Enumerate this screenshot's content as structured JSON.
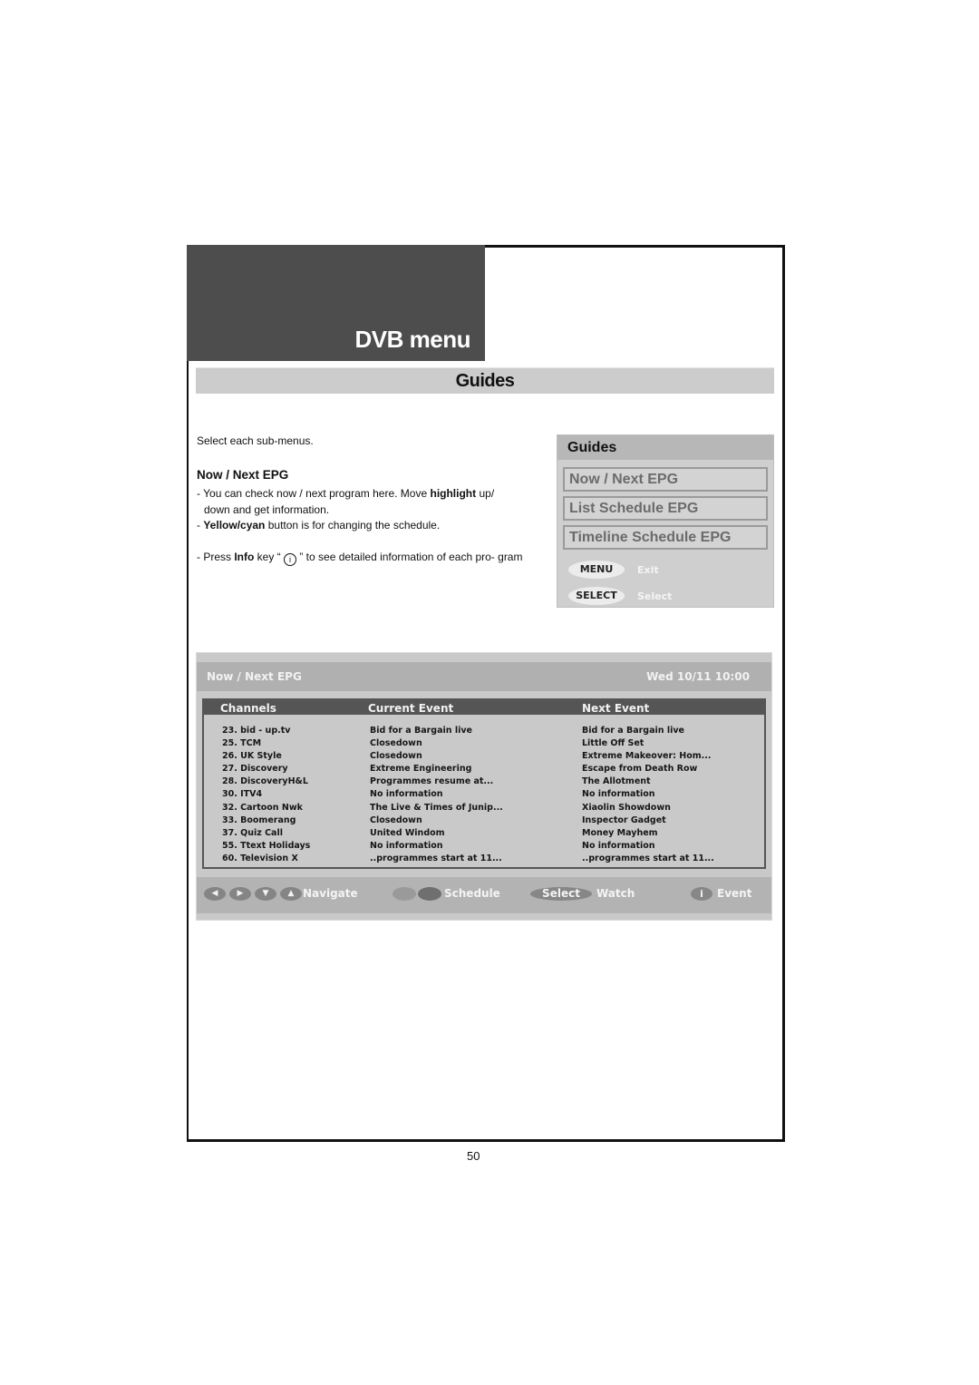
{
  "header": {
    "title": "DVB menu",
    "section": "Guides"
  },
  "intro": "Select each sub-menus.",
  "subsection": {
    "title": "Now / Next EPG",
    "bullets": [
      {
        "pre": "- You can check now / next program here. Move ",
        "bold": "highlight",
        "post": " up/ down and get information."
      },
      {
        "pre": "- ",
        "bold": "Yellow/cyan",
        "post": " button is for changing the schedule."
      },
      {
        "pre": "- Press ",
        "bold": "Info",
        "mid": " key “ ",
        "icon": "i",
        "post": " ” to see detailed information of each pro- gram"
      }
    ]
  },
  "guides_menu": {
    "title": "Guides",
    "items": [
      "Now / Next EPG",
      "List Schedule EPG",
      "Timeline Schedule EPG"
    ],
    "keys": [
      {
        "key": "MENU",
        "action": "Exit"
      },
      {
        "key": "SELECT",
        "action": "Select"
      }
    ]
  },
  "epg": {
    "title": "Now / Next EPG",
    "datetime": "Wed 10/11 10:00",
    "columns": [
      "Channels",
      "Current Event",
      "Next Event"
    ],
    "rows": [
      [
        "23. bid - up.tv",
        "Bid for a Bargain live",
        "Bid for a Bargain live"
      ],
      [
        "25. TCM",
        "Closedown",
        "Little Off Set"
      ],
      [
        "26. UK Style",
        "Closedown",
        "Extreme Makeover: Hom..."
      ],
      [
        "27. Discovery",
        "Extreme Engineering",
        "Escape from Death Row"
      ],
      [
        "28. DiscoveryH&L",
        "Programmes resume at...",
        "The Allotment"
      ],
      [
        "30. ITV4",
        "No information",
        "No information"
      ],
      [
        "32. Cartoon Nwk",
        "The Live & Times of Junip...",
        "Xiaolin Showdown"
      ],
      [
        "33. Boomerang",
        "Closedown",
        "Inspector Gadget"
      ],
      [
        "37. Quiz Call",
        "United Windom",
        "Money Mayhem"
      ],
      [
        "55. Ttext Holidays",
        "No information",
        "No information"
      ],
      [
        "60. Television X",
        "..programmes start at 11...",
        "..programmes start at 11..."
      ]
    ],
    "footer": {
      "nav_icons": [
        "◀",
        "▶",
        "▼",
        "▲"
      ],
      "navigate": "Navigate",
      "schedule": "Schedule",
      "select_key": "Select",
      "watch": "Watch",
      "info_key": "i",
      "event": "Event"
    }
  },
  "page_number": "50"
}
